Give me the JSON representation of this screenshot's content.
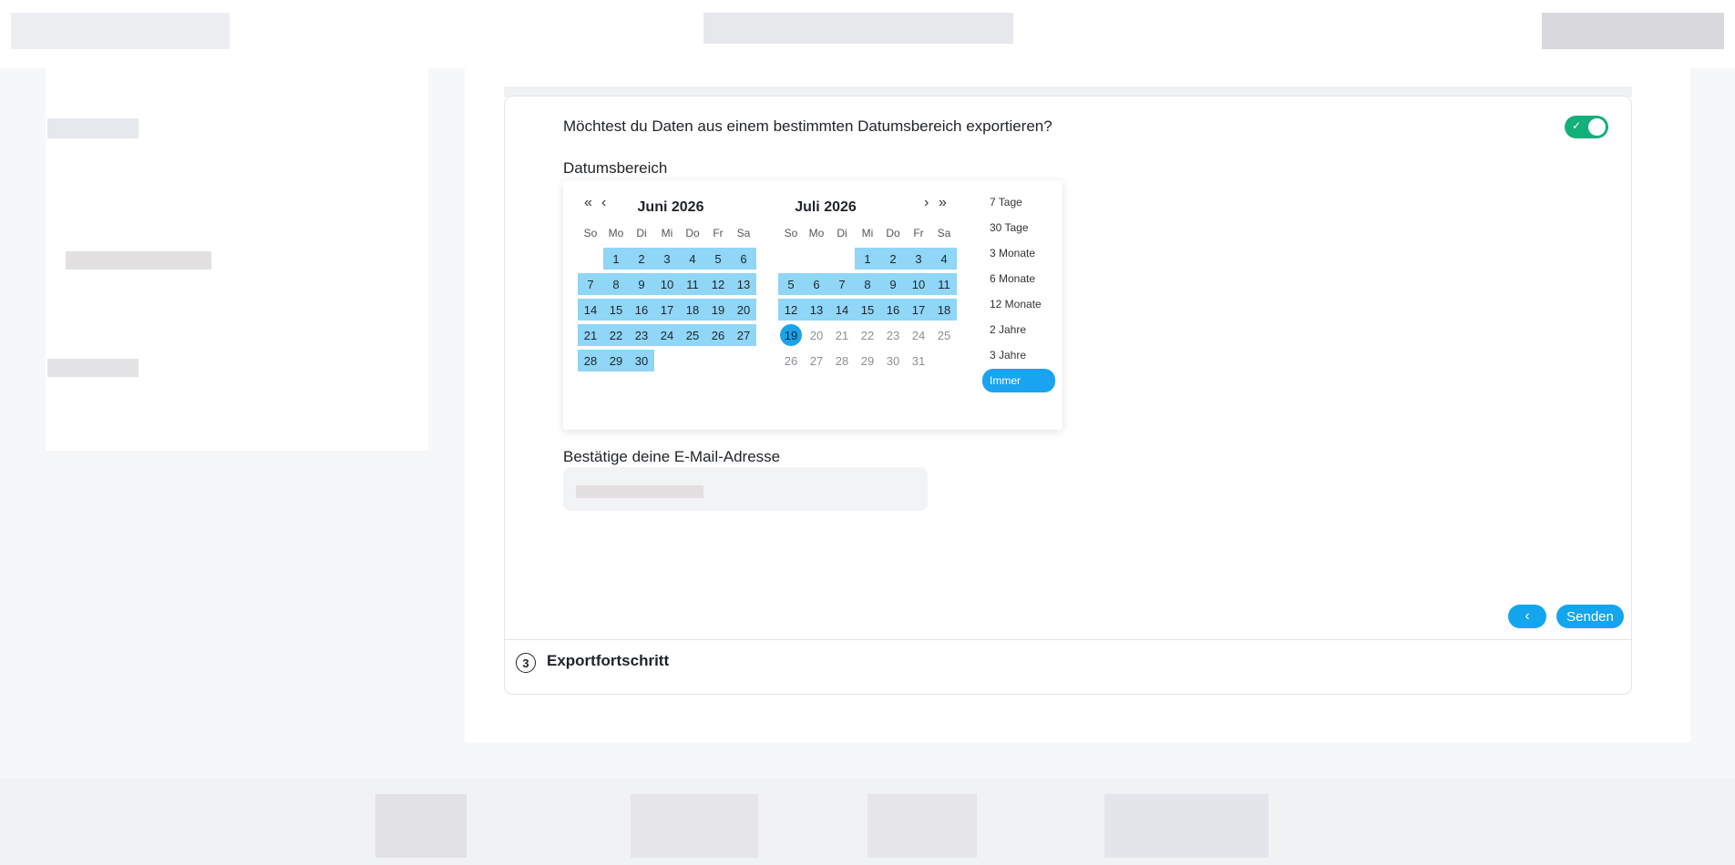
{
  "export": {
    "question": "Möchtest du Daten aus einem bestimmten Datumsbereich exportieren?",
    "toggle_check": "✓",
    "range_label": "Datumsbereich",
    "email_label": "Bestätige deine E-Mail-Adresse",
    "email_placeholder": "",
    "back_icon": "‹",
    "send_label": "Senden",
    "step_number": "3",
    "step_title": "Exportfortschritt"
  },
  "datepicker": {
    "nav": {
      "prev_year": "«",
      "prev_month": "‹",
      "next_month": "›",
      "next_year": "»"
    },
    "weekdays": [
      "So",
      "Mo",
      "Di",
      "Mi",
      "Do",
      "Fr",
      "Sa"
    ],
    "months": [
      {
        "title": "Juni 2026",
        "weeks": [
          [
            null,
            "1",
            "2",
            "3",
            "4",
            "5",
            "6"
          ],
          [
            "7",
            "8",
            "9",
            "10",
            "11",
            "12",
            "13"
          ],
          [
            "14",
            "15",
            "16",
            "17",
            "18",
            "19",
            "20"
          ],
          [
            "21",
            "22",
            "23",
            "24",
            "25",
            "26",
            "27"
          ],
          [
            "28",
            "29",
            "30",
            null,
            null,
            null,
            null
          ]
        ],
        "range": "all"
      },
      {
        "title": "Juli 2026",
        "weeks": [
          [
            null,
            null,
            null,
            "1",
            "2",
            "3",
            "4"
          ],
          [
            "5",
            "6",
            "7",
            "8",
            "9",
            "10",
            "11"
          ],
          [
            "12",
            "13",
            "14",
            "15",
            "16",
            "17",
            "18"
          ],
          [
            "19",
            "20",
            "21",
            "22",
            "23",
            "24",
            "25"
          ],
          [
            "26",
            "27",
            "28",
            "29",
            "30",
            "31",
            null
          ]
        ],
        "range_end": "19",
        "today": "19"
      }
    ],
    "presets": [
      "7 Tage",
      "30 Tage",
      "3 Monate",
      "6 Monate",
      "12 Monate",
      "2 Jahre",
      "3 Jahre",
      "Immer"
    ],
    "active_preset": "Immer"
  },
  "colors": {
    "accent": "#14a5ef",
    "range_fill": "#8fd6f7",
    "toggle_on": "#14b07a"
  }
}
